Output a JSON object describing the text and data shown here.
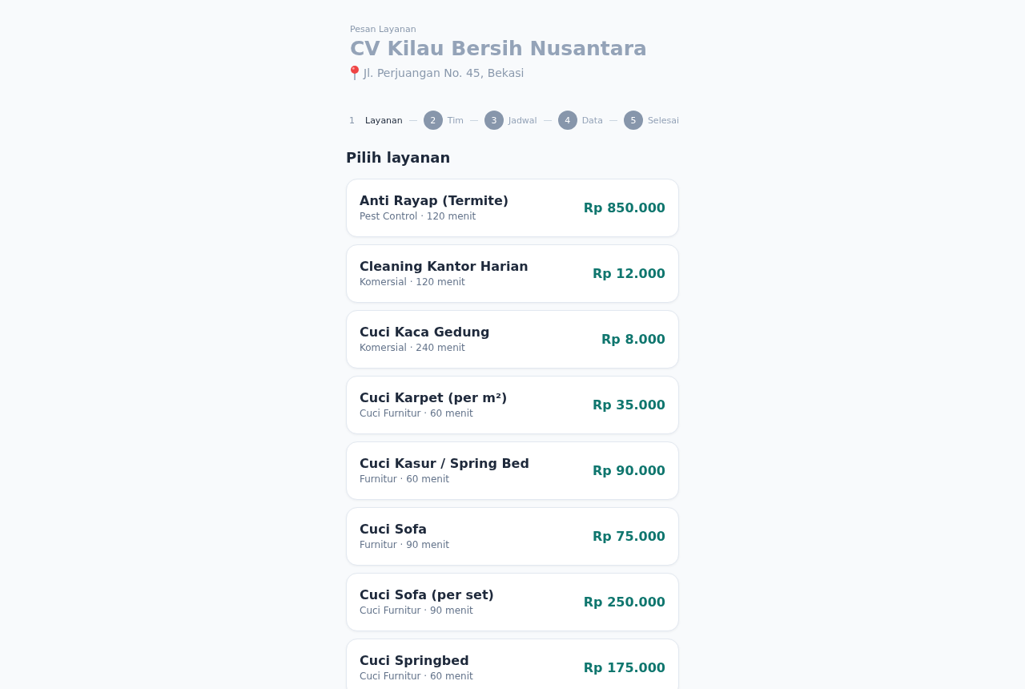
{
  "header": {
    "eyebrow": "Pesan Layanan",
    "title": "CV Kilau Bersih Nusantara",
    "address": "Jl. Perjuangan No. 45, Bekasi"
  },
  "steps": [
    {
      "number": "1",
      "label": "Layanan",
      "selected": true
    },
    {
      "number": "2",
      "label": "Tim",
      "selected": false
    },
    {
      "number": "3",
      "label": "Jadwal",
      "selected": false
    },
    {
      "number": "4",
      "label": "Data",
      "selected": false
    },
    {
      "number": "5",
      "label": "Selesai",
      "selected": false
    }
  ],
  "heading": "Pilih layanan",
  "services": [
    {
      "name": "Anti Rayap (Termite)",
      "meta": "Pest Control · 120 menit",
      "price": "Rp 850.000"
    },
    {
      "name": "Cleaning Kantor Harian",
      "meta": "Komersial · 120 menit",
      "price": "Rp 12.000"
    },
    {
      "name": "Cuci Kaca Gedung",
      "meta": "Komersial · 240 menit",
      "price": "Rp 8.000"
    },
    {
      "name": "Cuci Karpet (per m²)",
      "meta": "Cuci Furnitur · 60 menit",
      "price": "Rp 35.000"
    },
    {
      "name": "Cuci Kasur / Spring Bed",
      "meta": "Furnitur · 60 menit",
      "price": "Rp 90.000"
    },
    {
      "name": "Cuci Sofa",
      "meta": "Furnitur · 90 menit",
      "price": "Rp 75.000"
    },
    {
      "name": "Cuci Sofa (per set)",
      "meta": "Cuci Furnitur · 90 menit",
      "price": "Rp 250.000"
    },
    {
      "name": "Cuci Springbed",
      "meta": "Cuci Furnitur · 60 menit",
      "price": "Rp 175.000"
    }
  ]
}
